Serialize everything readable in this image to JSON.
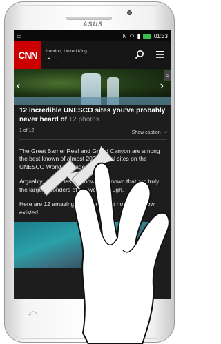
{
  "device": {
    "brand": "ASUS"
  },
  "status_bar": {
    "time": "01:33",
    "network": "N"
  },
  "app": {
    "logo": "CNN",
    "weather": {
      "location": "London, United King...",
      "temperature": "1°",
      "icon": "cloud-sun-icon"
    },
    "search_icon": "search-icon",
    "menu_icon": "menu-icon"
  },
  "article": {
    "headline": "12 incredible UNESCO sites you've probably never heard of",
    "photos_label": "12 photos",
    "counter": "1 of 12",
    "caption_toggle": "Show caption",
    "paragraphs": [
      "The Great Barrier Reef and Grand Canyon are among the best known of almost 200 natural sites on the UNESCO World Heritage List.",
      "Arguably, it's the lesser known, unknown that are truly the largest wonders of the world though.",
      "Here are 12 amazing sites you might not even know existed."
    ]
  },
  "navigation": {
    "back_icon": "back-icon"
  },
  "gesture": {
    "type": "pinch",
    "icon": "pinch-gesture-icon"
  }
}
